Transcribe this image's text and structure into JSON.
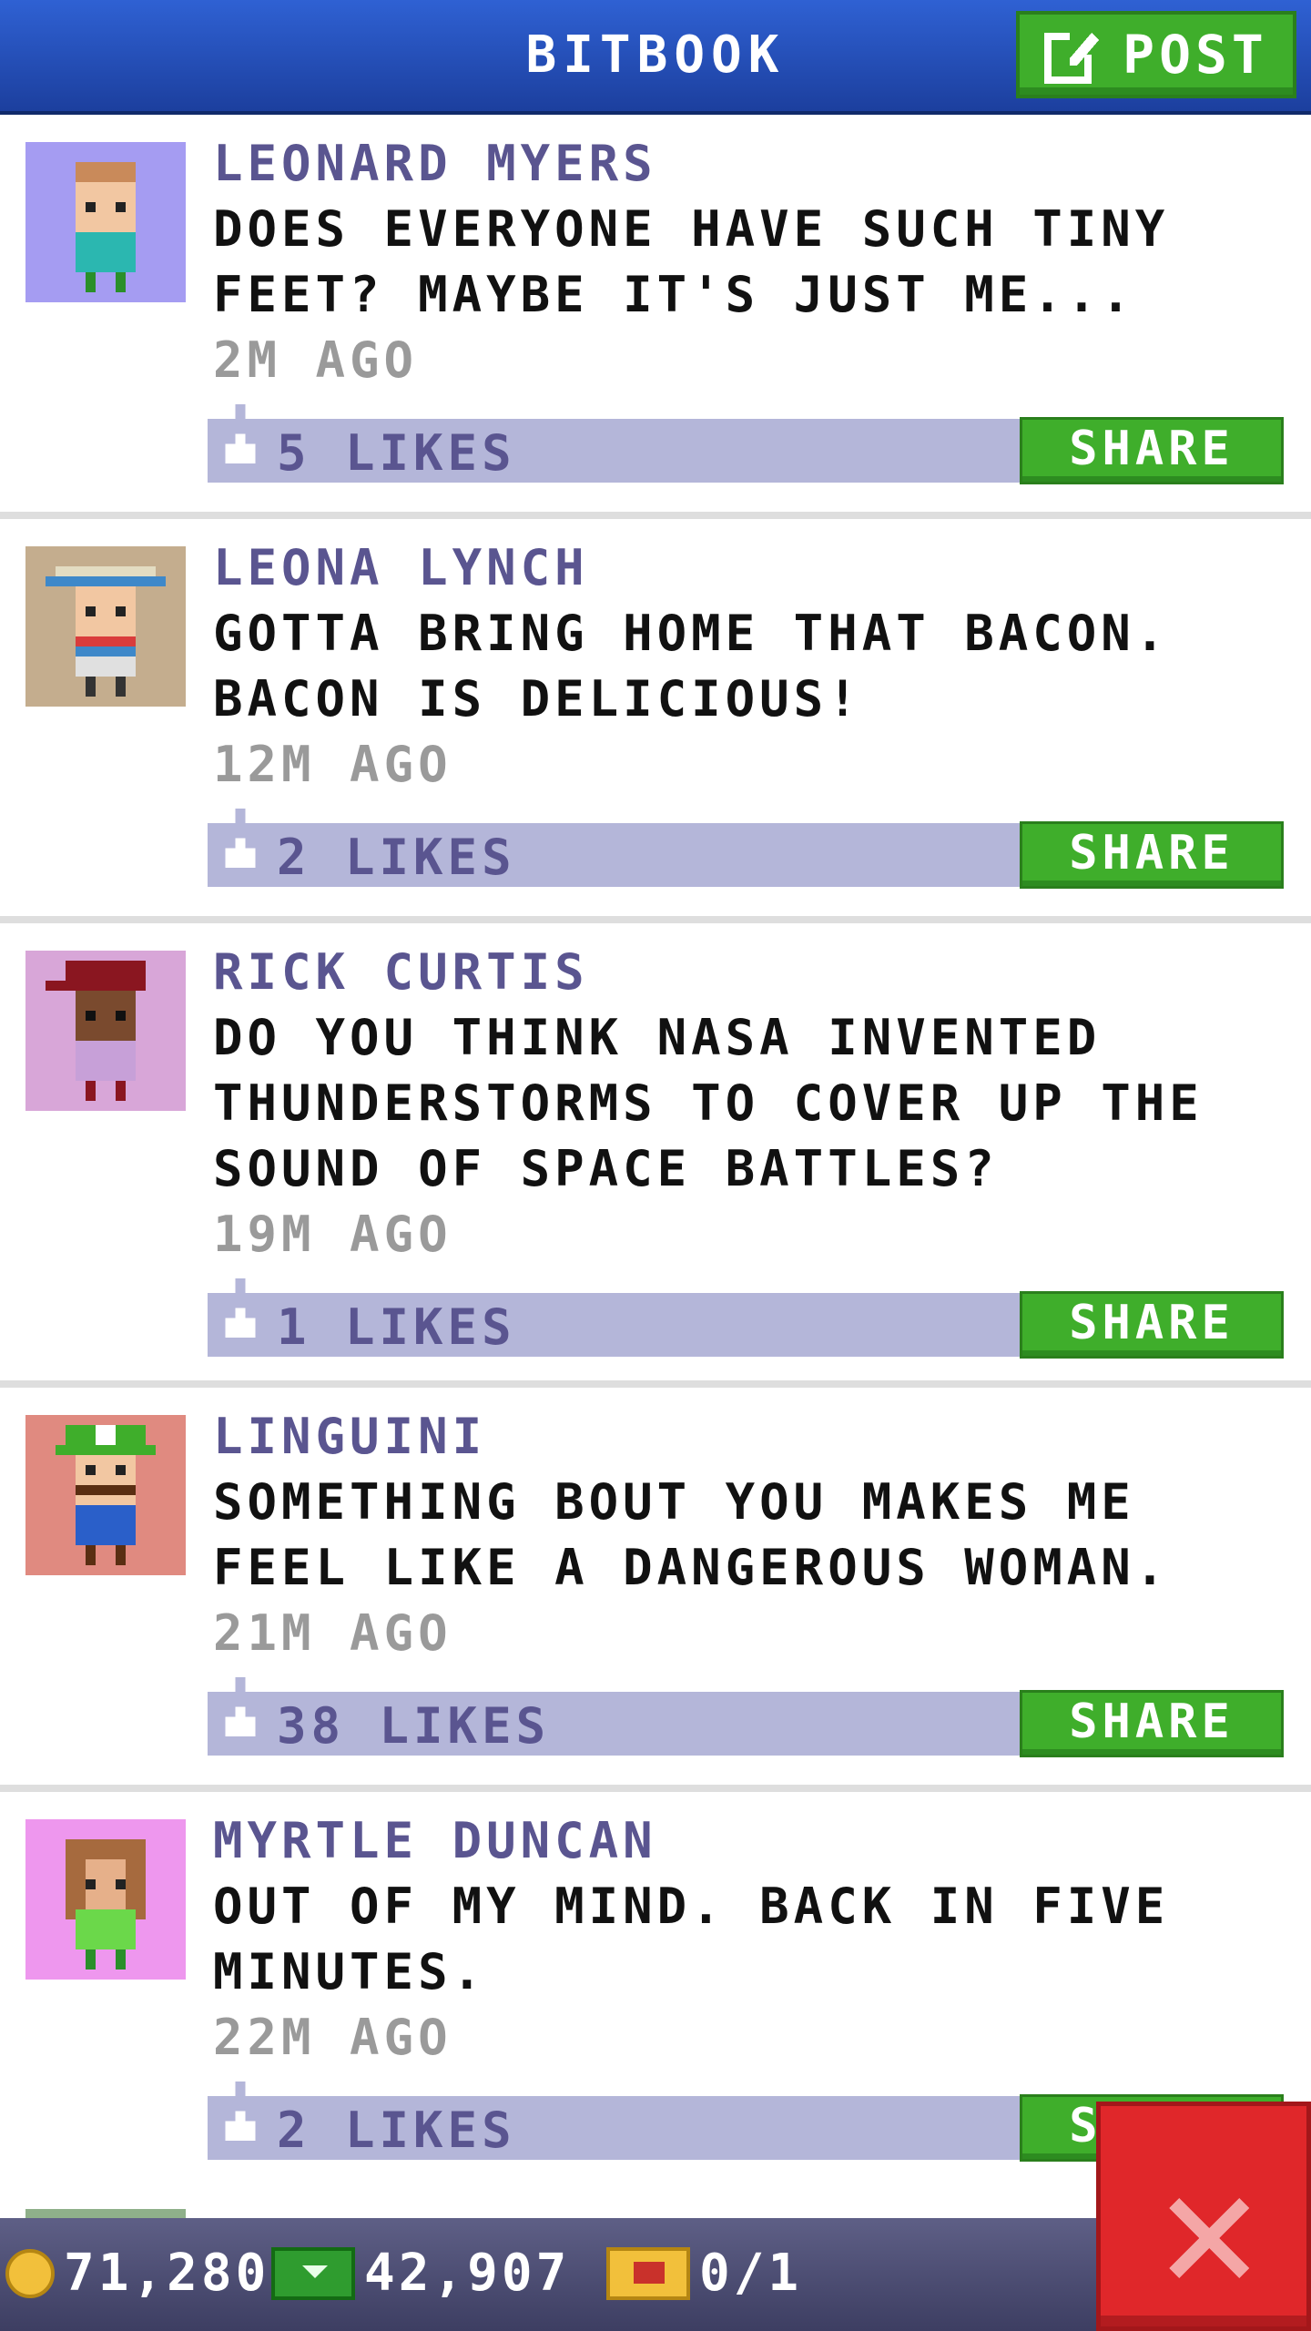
{
  "header": {
    "title": "BITBOOK",
    "post_label": "POST"
  },
  "posts": [
    {
      "author": "LEONARD MYERS",
      "message": "DOES EVERYONE HAVE SUCH TINY FEET? MAYBE IT'S JUST ME...",
      "time": "2M AGO",
      "likes": "5 LIKES",
      "share": "SHARE"
    },
    {
      "author": "LEONA LYNCH",
      "message": "GOTTA BRING HOME THAT BACON. BACON IS DELICIOUS!",
      "time": "12M AGO",
      "likes": "2 LIKES",
      "share": "SHARE"
    },
    {
      "author": "RICK CURTIS",
      "message": "DO YOU THINK NASA INVENTED THUNDERSTORMS TO COVER UP THE SOUND OF SPACE BATTLES?",
      "time": "19M AGO",
      "likes": "1 LIKES",
      "share": "SHARE"
    },
    {
      "author": "LINGUINI",
      "message": "SOMETHING BOUT YOU MAKES ME FEEL LIKE A DANGEROUS WOMAN.",
      "time": "21M AGO",
      "likes": "38 LIKES",
      "share": "SHARE"
    },
    {
      "author": "MYRTLE DUNCAN",
      "message": "OUT OF MY MIND. BACK IN FIVE MINUTES.",
      "time": "22M AGO",
      "likes": "2 LIKES",
      "share": "SHARE"
    }
  ],
  "bottom_bar": {
    "coins": "71,280",
    "bux": "42,907",
    "tickets": "0/1"
  },
  "icons": {
    "post": "edit-icon",
    "like": "thumbs-up-icon",
    "coins": "coin-icon",
    "bux": "bux-icon",
    "tickets": "ticket-icon",
    "close": "close-icon"
  },
  "colors": {
    "header": "#2448b8",
    "button_green": "#3fae2b",
    "like_bar": "#b4b6d9",
    "close_red": "#e0272a"
  }
}
